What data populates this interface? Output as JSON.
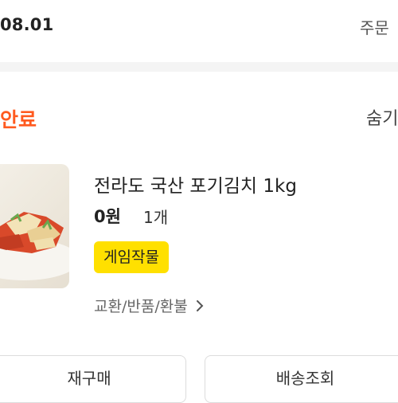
{
  "order": {
    "date": "08.01",
    "order_link": "주문",
    "status": "안료",
    "hide_link": "숨기"
  },
  "product": {
    "name": "전라도 국산 포기김치 1kg",
    "price": "0원",
    "quantity": "1개",
    "badge": "게임작물",
    "exchange_link": "교환/반품/환불"
  },
  "buttons": {
    "reorder": "재구매",
    "track": "배송조회"
  },
  "colors": {
    "status": "#ff5a1f",
    "badge": "#ffe000"
  },
  "icons": {
    "exchange_chevron": "chevron-right-icon"
  }
}
